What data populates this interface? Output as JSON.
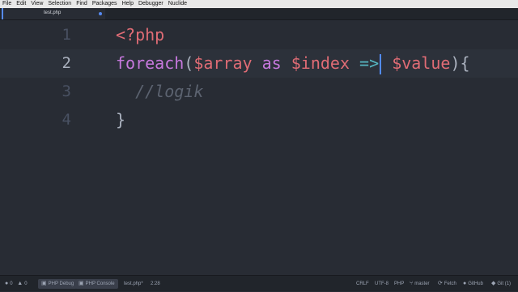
{
  "menu": [
    "File",
    "Edit",
    "View",
    "Selection",
    "Find",
    "Packages",
    "Help",
    "Debugger",
    "Nuclide"
  ],
  "tab": {
    "title": "test.php"
  },
  "editor": {
    "lines": [
      {
        "number": "1",
        "tokens": [
          {
            "text": "<?php",
            "kind": "tag"
          }
        ]
      },
      {
        "number": "2",
        "tokens": [
          {
            "text": "foreach",
            "kind": "kw"
          },
          {
            "text": "(",
            "kind": "plain"
          },
          {
            "text": "$array",
            "kind": "var"
          },
          {
            "text": " as ",
            "kind": "kw"
          },
          {
            "text": "$index",
            "kind": "var"
          },
          {
            "text": " =>",
            "kind": "op"
          },
          {
            "text": " ",
            "kind": "plain"
          },
          {
            "text": "$value",
            "kind": "var"
          },
          {
            "text": "){",
            "kind": "plain"
          }
        ]
      },
      {
        "number": "3",
        "tokens": [
          {
            "text": "  //logik",
            "kind": "com"
          }
        ]
      },
      {
        "number": "4",
        "tokens": [
          {
            "text": "}",
            "kind": "plain"
          }
        ]
      }
    ]
  },
  "status": {
    "errors": "0",
    "warnings": "0",
    "php_debug": "PHP Debug",
    "php_console": "PHP Console",
    "file": "test.php*",
    "cursor": "2:28",
    "line_ending": "CRLF",
    "encoding": "UTF-8",
    "grammar": "PHP",
    "branch": "master",
    "fetch": "Fetch",
    "github": "GitHub",
    "git": "Git (1)"
  }
}
